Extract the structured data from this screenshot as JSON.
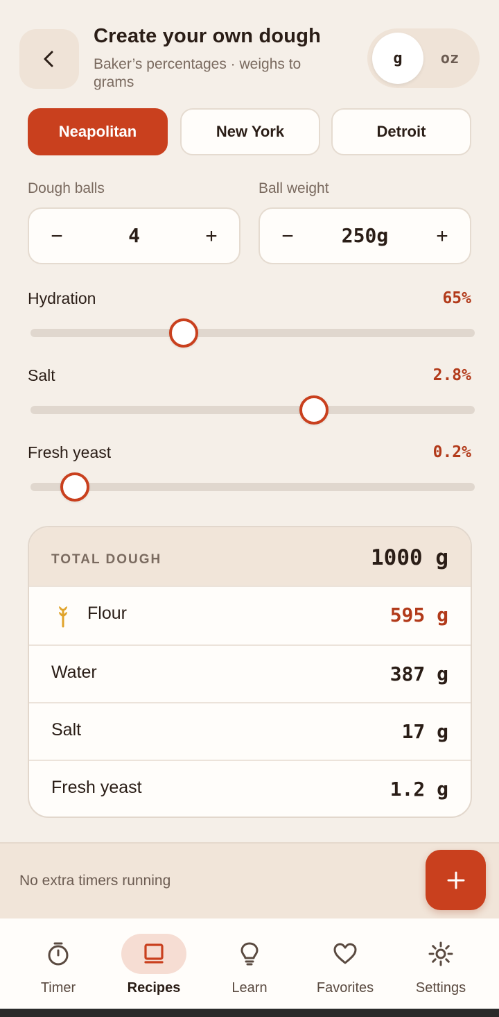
{
  "header": {
    "title": "Create your own dough",
    "subtitle": "Baker’s percentages · weighs to grams",
    "back_icon": "chevron-left-icon",
    "units": [
      {
        "label": "g",
        "active": true
      },
      {
        "label": "oz",
        "active": false
      }
    ]
  },
  "styles": [
    {
      "label": "Neapolitan",
      "active": true
    },
    {
      "label": "New York",
      "active": false
    },
    {
      "label": "Detroit",
      "active": false
    }
  ],
  "dough_balls": {
    "label": "Dough balls",
    "value": "4",
    "minus": "−",
    "plus": "+"
  },
  "ball_weight": {
    "label": "Ball weight",
    "value": "250g",
    "minus": "−",
    "plus": "+"
  },
  "sliders": [
    {
      "label": "Hydration",
      "value": "65%",
      "level": 0.345
    },
    {
      "label": "Salt",
      "value": "2.8%",
      "level": 0.638
    },
    {
      "label": "Fresh yeast",
      "value": "0.2%",
      "level": 0.1
    }
  ],
  "totals": {
    "header_label": "TOTAL DOUGH",
    "total": "1000 g",
    "rows": [
      {
        "label": "Flour",
        "value": "595 g",
        "icon": "wheat-icon"
      },
      {
        "label": "Water",
        "value": "387 g"
      },
      {
        "label": "Salt",
        "value": "17 g"
      },
      {
        "label": "Fresh yeast",
        "value": "1.2 g"
      }
    ]
  },
  "timers": {
    "status": "No extra timers running",
    "add_icon": "plus-icon"
  },
  "nav": [
    {
      "label": "Timer",
      "icon": "stopwatch-icon",
      "active": false
    },
    {
      "label": "Recipes",
      "icon": "book-icon",
      "active": true
    },
    {
      "label": "Learn",
      "icon": "lightbulb-icon",
      "active": false
    },
    {
      "label": "Favorites",
      "icon": "heart-icon",
      "active": false
    },
    {
      "label": "Settings",
      "icon": "gear-icon",
      "active": false
    }
  ],
  "colors": {
    "accent": "#c9401e",
    "accent_text": "#b23a1a",
    "background": "#f5efe8",
    "panel": "#f1e5d9",
    "wheat": "#e0a32a"
  }
}
